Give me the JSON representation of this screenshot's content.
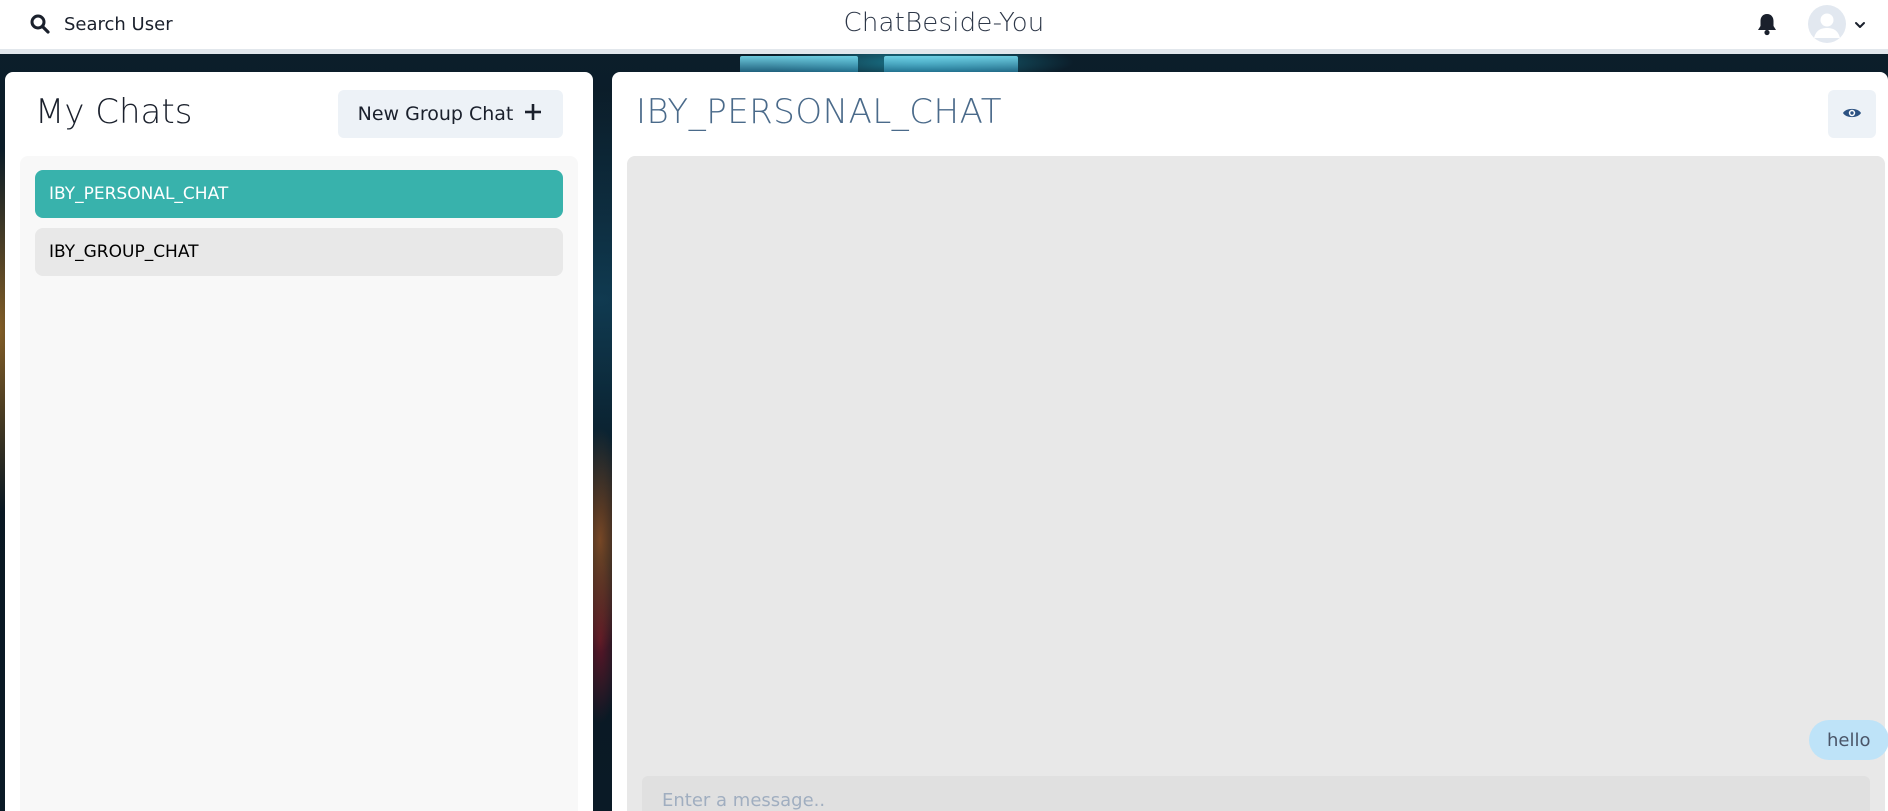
{
  "header": {
    "search_label": "Search User",
    "search_icon": "search-icon",
    "app_title": "ChatBeside-You",
    "notification_icon": "bell-icon",
    "avatar_icon": "user-avatar-icon",
    "menu_icon": "chevron-down-icon"
  },
  "sidebar": {
    "title": "My Chats",
    "new_group_label": "New Group Chat",
    "new_group_icon": "plus-icon",
    "chats": [
      {
        "name": "IBY_PERSONAL_CHAT",
        "active": true
      },
      {
        "name": "IBY_GROUP_CHAT",
        "active": false
      }
    ]
  },
  "chat": {
    "title": "IBY_PERSONAL_CHAT",
    "view_icon": "eye-icon",
    "messages": [
      {
        "text": "hello",
        "sent": true
      }
    ],
    "input_placeholder": "Enter a message.."
  },
  "colors": {
    "accent": "#38b2ac",
    "bubble": "#bee3f8",
    "panel_bg": "#e8e8e8"
  }
}
